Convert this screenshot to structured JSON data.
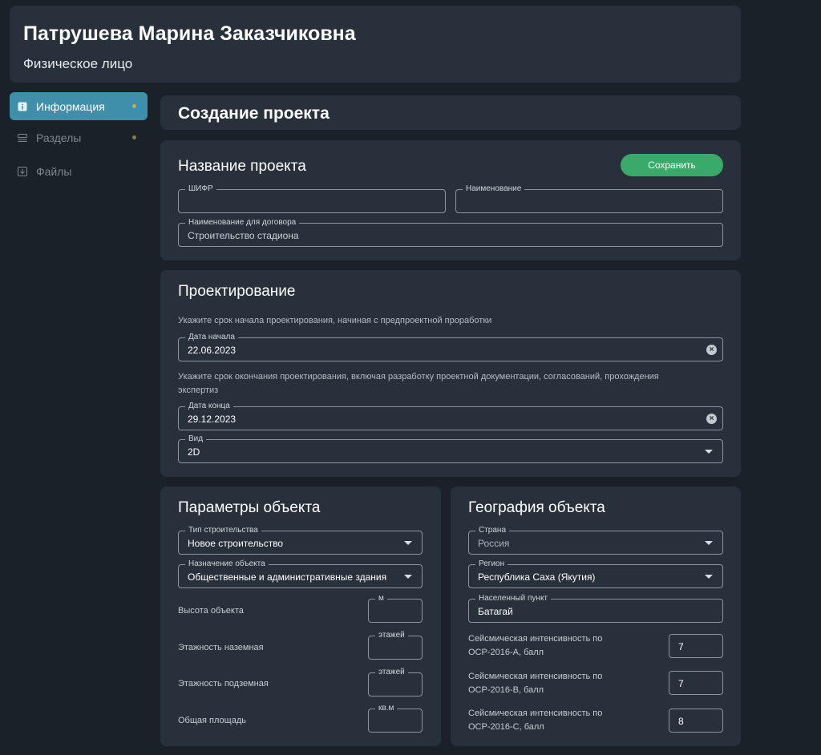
{
  "header": {
    "name": "Патрушева Марина Заказчиковна",
    "person_type": "Физическое лицо"
  },
  "sidebar": {
    "items": [
      {
        "label": "Информация",
        "icon": "info-icon",
        "active": true
      },
      {
        "label": "Разделы",
        "icon": "layers-icon",
        "active": false
      },
      {
        "label": "Файлы",
        "icon": "download-icon",
        "active": false
      }
    ]
  },
  "page": {
    "title": "Создание проекта"
  },
  "project_name": {
    "title": "Название проекта",
    "save_label": "Сохранить",
    "cipher": {
      "label": "ШИФР",
      "value": ""
    },
    "name": {
      "label": "Наименование",
      "value": ""
    },
    "contract_name": {
      "label": "Наименование для договора",
      "value": "Строительство стадиона"
    }
  },
  "design": {
    "title": "Проектирование",
    "start_hint": "Укажите срок начала проектирования, начиная с предпроектной проработки",
    "start_date": {
      "label": "Дата начала",
      "value": "22.06.2023"
    },
    "end_hint": "Укажите срок окончания проектирования, включая разработку проектной документации, согласований, прохождения экспертиз",
    "end_date": {
      "label": "Дата конца",
      "value": "29.12.2023"
    },
    "kind": {
      "label": "Вид",
      "value": "2D"
    }
  },
  "object_params": {
    "title": "Параметры объекта",
    "construction_type": {
      "label": "Тип строительства",
      "value": "Новое строительство"
    },
    "purpose": {
      "label": "Назначение объекта",
      "value": "Общественные и административные здания"
    },
    "height": {
      "label": "Высота объекта",
      "unit": "м",
      "value": ""
    },
    "floors_above": {
      "label": "Этажность наземная",
      "unit": "этажей",
      "value": ""
    },
    "floors_below": {
      "label": "Этажность подземная",
      "unit": "этажей",
      "value": ""
    },
    "area": {
      "label": "Общая площадь",
      "unit": "кв.м",
      "value": ""
    }
  },
  "geography": {
    "title": "География объекта",
    "country": {
      "label": "Страна",
      "value": "Россия"
    },
    "region": {
      "label": "Регион",
      "value": "Республика Саха (Якутия)"
    },
    "settlement": {
      "label": "Населенный пункт",
      "value": "Батагай"
    },
    "seismic_a": {
      "label": "Сейсмическая интенсивность по ОСР-2016-А, балл",
      "value": "7"
    },
    "seismic_b": {
      "label": "Сейсмическая интенсивность по ОСР-2016-В, балл",
      "value": "7"
    },
    "seismic_c": {
      "label": "Сейсмическая интенсивность по ОСР-2016-С, балл",
      "value": "8"
    }
  },
  "colors": {
    "background": "#1a2128",
    "panel": "#28313b",
    "accent": "#3f8eaa",
    "save": "#3aaa6a",
    "badge_dot": "#e0a43c"
  }
}
